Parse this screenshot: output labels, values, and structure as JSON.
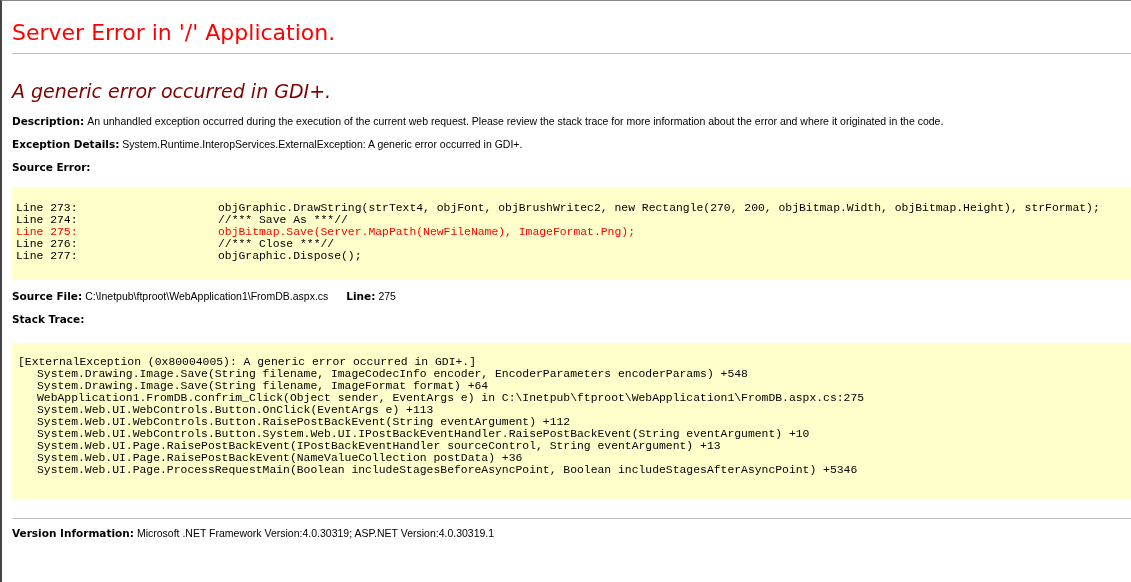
{
  "title": "Server Error in '/' Application.",
  "error_message": "A generic error occurred in GDI+.",
  "description": {
    "label": "Description:",
    "text": "An unhandled exception occurred during the execution of the current web request. Please review the stack trace for more information about the error and where it originated in the code."
  },
  "exception_details": {
    "label": "Exception Details:",
    "text": "System.Runtime.InteropServices.ExternalException: A generic error occurred in GDI+."
  },
  "source_error": {
    "label": "Source Error:",
    "lines": [
      {
        "label": "Line 273:",
        "code": "objGraphic.DrawString(strText4, objFont, objBrushWritec2, new Rectangle(270, 200, objBitmap.Width, objBitmap.Height), strFormat);",
        "highlighted": false
      },
      {
        "label": "Line 274:",
        "code": "//*** Save As ***//",
        "highlighted": false
      },
      {
        "label": "Line 275:",
        "code": "objBitmap.Save(Server.MapPath(NewFileName), ImageFormat.Png);",
        "highlighted": true
      },
      {
        "label": "Line 276:",
        "code": "//*** Close ***//",
        "highlighted": false
      },
      {
        "label": "Line 277:",
        "code": "objGraphic.Dispose();",
        "highlighted": false
      }
    ]
  },
  "source_file": {
    "label": "Source File:",
    "path": "C:\\Inetpub\\ftproot\\WebApplication1\\FromDB.aspx.cs",
    "line_label": "Line:",
    "line": "275"
  },
  "stack_trace": {
    "label": "Stack Trace:",
    "header": "[ExternalException (0x80004005): A generic error occurred in GDI+.]",
    "frames": [
      "System.Drawing.Image.Save(String filename, ImageCodecInfo encoder, EncoderParameters encoderParams) +548",
      "System.Drawing.Image.Save(String filename, ImageFormat format) +64",
      "WebApplication1.FromDB.confrim_Click(Object sender, EventArgs e) in C:\\Inetpub\\ftproot\\WebApplication1\\FromDB.aspx.cs:275",
      "System.Web.UI.WebControls.Button.OnClick(EventArgs e) +113",
      "System.Web.UI.WebControls.Button.RaisePostBackEvent(String eventArgument) +112",
      "System.Web.UI.WebControls.Button.System.Web.UI.IPostBackEventHandler.RaisePostBackEvent(String eventArgument) +10",
      "System.Web.UI.Page.RaisePostBackEvent(IPostBackEventHandler sourceControl, String eventArgument) +13",
      "System.Web.UI.Page.RaisePostBackEvent(NameValueCollection postData) +36",
      "System.Web.UI.Page.ProcessRequestMain(Boolean includeStagesBeforeAsyncPoint, Boolean includeStagesAfterAsyncPoint) +5346"
    ]
  },
  "version_information": {
    "label": "Version Information:",
    "text": "Microsoft .NET Framework Version:4.0.30319; ASP.NET Version:4.0.30319.1"
  }
}
